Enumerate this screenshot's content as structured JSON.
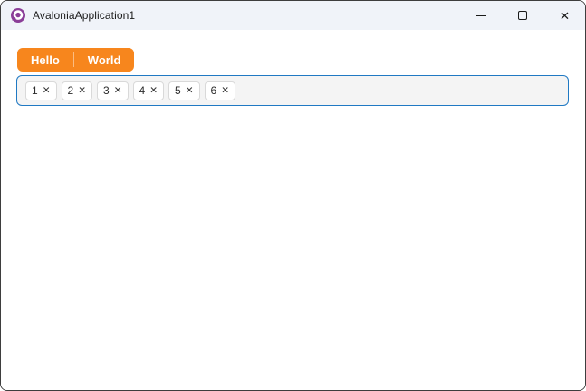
{
  "window": {
    "title": "AvaloniaApplication1"
  },
  "icons": {
    "app_logo": "avalonia-purple-circle",
    "minimize": "horizontal-bar-css-shape",
    "maximize": "outlined-square-css-shape",
    "close_glyph": "✕",
    "remove_glyph": "✕"
  },
  "tabstrip": {
    "items": [
      "Hello",
      "World"
    ]
  },
  "chips": {
    "items": [
      "1",
      "2",
      "3",
      "4",
      "5",
      "6"
    ]
  },
  "colors": {
    "titlebar_bg": "#F0F3F9",
    "window_border": "#3E3E3E",
    "accent_orange": "#F7861D",
    "focus_border_blue": "#2079C3",
    "chip_box_bg": "#F4F4F4",
    "chip_bg": "#FFFFFF",
    "chip_border": "#D9D9D9",
    "logo_purple": "#8B3E98"
  }
}
